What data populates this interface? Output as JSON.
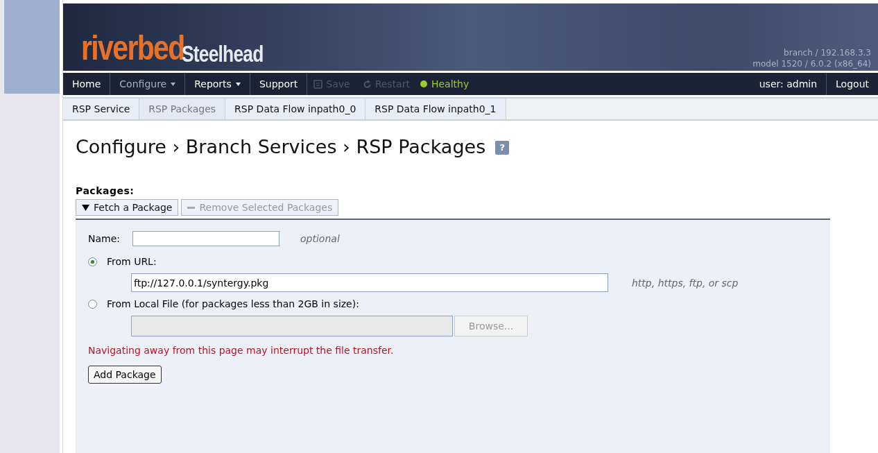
{
  "header": {
    "logo_brand": "riverbed",
    "logo_product": "Steelhead",
    "host": "branch / 192.168.3.3",
    "model": "model 1520 / 6.0.2 (x86_64)"
  },
  "nav": [
    {
      "label": "Home",
      "kind": "link",
      "caret": false,
      "selected": false
    },
    {
      "label": "Configure",
      "kind": "link",
      "caret": true,
      "selected": true
    },
    {
      "label": "Reports",
      "kind": "link",
      "caret": true,
      "selected": false
    },
    {
      "label": "Support",
      "kind": "link",
      "caret": false,
      "selected": false
    },
    {
      "label": "Save",
      "kind": "save",
      "disabled": true
    },
    {
      "label": "Restart",
      "kind": "restart",
      "disabled": true
    },
    {
      "label": "Healthy",
      "kind": "status",
      "color": "#9acd32"
    }
  ],
  "user": "user: admin",
  "logout": "Logout",
  "subtabs": [
    {
      "label": "RSP Service",
      "selected": false
    },
    {
      "label": "RSP Packages",
      "selected": true
    },
    {
      "label": "RSP Data Flow inpath0_0",
      "selected": false
    },
    {
      "label": "RSP Data Flow inpath0_1",
      "selected": false
    }
  ],
  "breadcrumb": "Configure › Branch Services › RSP Packages",
  "help": "?",
  "section_title": "Packages:",
  "actions": [
    {
      "label": "Fetch a Package",
      "kind": "expand",
      "disabled": false
    },
    {
      "label": "Remove Selected Packages",
      "kind": "remove",
      "disabled": true
    }
  ],
  "form": {
    "name_label": "Name:",
    "name_hint": "optional",
    "sources": [
      {
        "label": "From URL:",
        "selected": true,
        "value": "ftp://127.0.0.1/syntergy.pkg",
        "hint": "http, https, ftp, or scp",
        "kind": "url"
      },
      {
        "label": "From Local File (for packages less than 2GB in size):",
        "selected": false,
        "kind": "file",
        "browse": "Browse..."
      }
    ],
    "warning": "Navigating away from this page may interrupt the file transfer.",
    "submit": "Add Package"
  }
}
